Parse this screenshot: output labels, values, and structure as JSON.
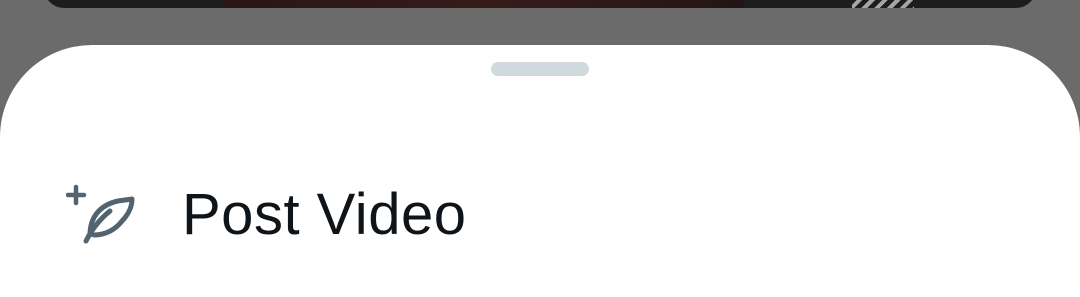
{
  "background": {
    "dim_color": "#6b6b6b",
    "media_peek_color": "#1d1d1d"
  },
  "sheet": {
    "background_color": "#ffffff",
    "handle_color": "#cfd9de",
    "items": [
      {
        "label": "Post Video",
        "icon": "compose-feather-plus-icon",
        "icon_color": "#536471",
        "text_color": "#0f1419"
      }
    ]
  }
}
